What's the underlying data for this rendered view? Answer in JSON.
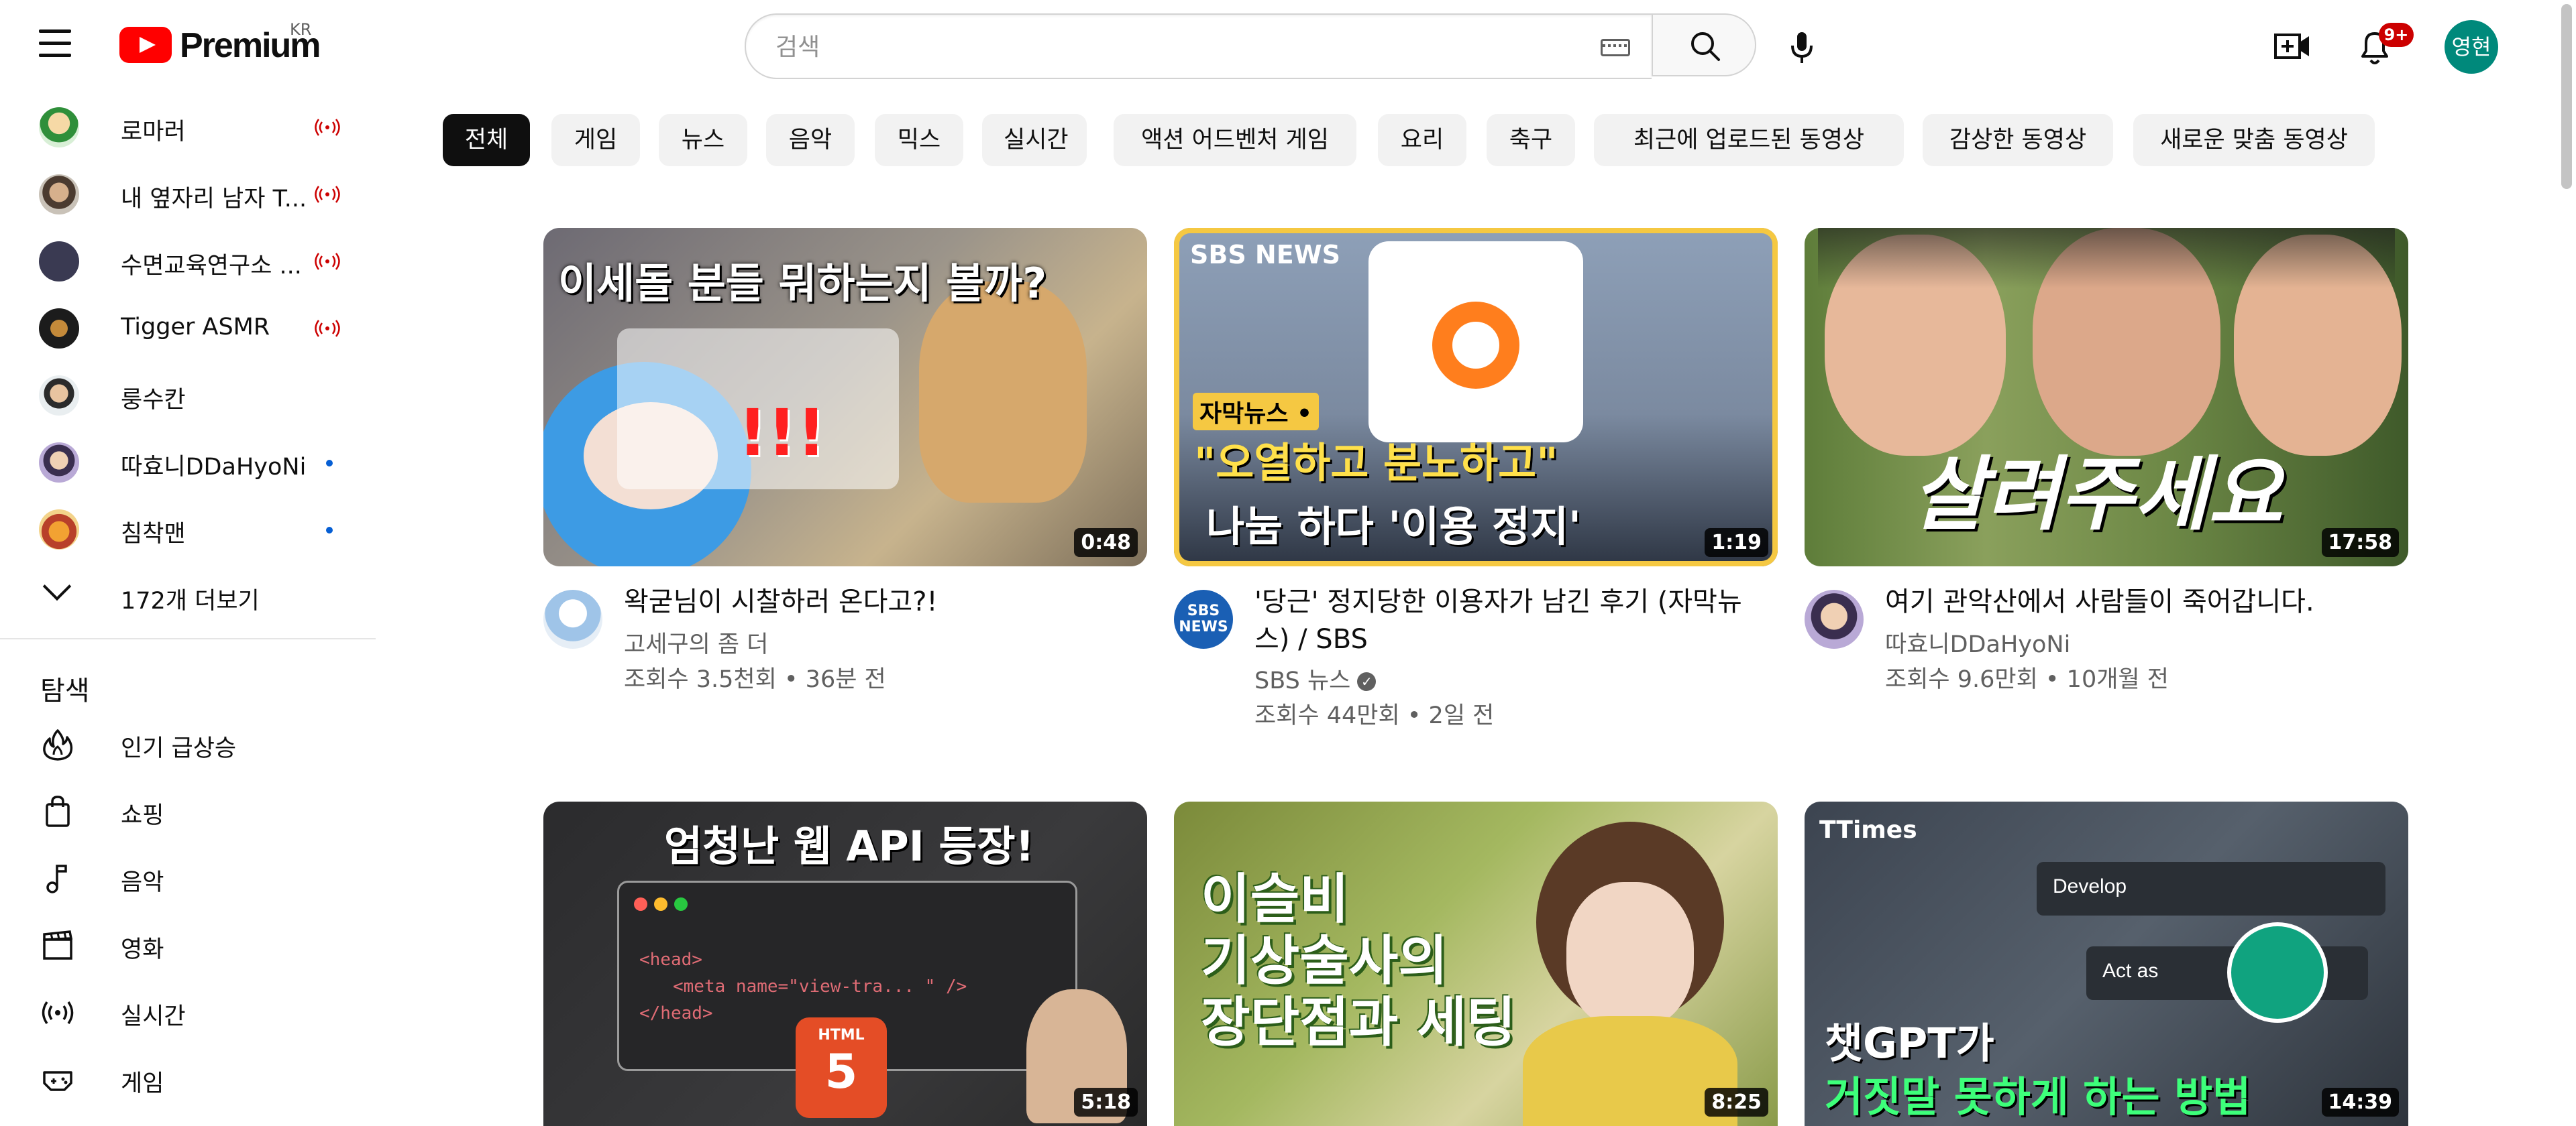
{
  "header": {
    "logo_text": "Premium",
    "region": "KR",
    "search_placeholder": "검색",
    "notification_count": "9+",
    "user_avatar_text": "영현"
  },
  "sidebar": {
    "subscriptions": [
      {
        "name": "로마러",
        "indicator": "live"
      },
      {
        "name": "내 옆자리 남자 T...",
        "indicator": "live"
      },
      {
        "name": "수면교육연구소 ...",
        "indicator": "live"
      },
      {
        "name": "Tigger ASMR",
        "indicator": "live"
      },
      {
        "name": "룽수칸",
        "indicator": "none"
      },
      {
        "name": "따효니DDaHyoNi",
        "indicator": "new"
      },
      {
        "name": "침착맨",
        "indicator": "new"
      }
    ],
    "show_more": "172개 더보기",
    "explore_title": "탐색",
    "explore_items": [
      {
        "label": "인기 급상승",
        "icon": "fire-icon"
      },
      {
        "label": "쇼핑",
        "icon": "shopping-bag-icon"
      },
      {
        "label": "음악",
        "icon": "music-note-icon"
      },
      {
        "label": "영화",
        "icon": "clapperboard-icon"
      },
      {
        "label": "실시간",
        "icon": "live-icon"
      },
      {
        "label": "게임",
        "icon": "gamepad-icon"
      }
    ]
  },
  "chips": [
    "전체",
    "게임",
    "뉴스",
    "음악",
    "믹스",
    "실시간",
    "액션 어드벤처 게임",
    "요리",
    "축구",
    "최근에 업로드된 동영상",
    "감상한 동영상",
    "새로운 맞춤 동영상"
  ],
  "videos": [
    {
      "title": "왁굳님이 시찰하러 온다고?!",
      "channel": "고세구의 좀 더",
      "verified": false,
      "stats": "조회수 3.5천회 • 36분 전",
      "duration": "0:48",
      "thumb_text": "이세돌 분들 뭐하는지 볼까?"
    },
    {
      "title": "'당근' 정지당한 이용자가 남긴 후기 (자막뉴스) / SBS",
      "channel": "SBS 뉴스",
      "verified": true,
      "stats": "조회수 44만회 • 2일 전",
      "duration": "1:19",
      "thumb_text_1": "\"오열하고 분노하고\"",
      "thumb_text_2": "나눔 하다 '이용 정지'",
      "thumb_tag": "자막뉴스 •",
      "thumb_brand": "SBS NEWS"
    },
    {
      "title": "여기 관악산에서 사람들이 죽어갑니다.",
      "channel": "따효니DDaHyoNi",
      "verified": false,
      "stats": "조회수 9.6만회 • 10개월 전",
      "duration": "17:58",
      "thumb_text": "살려주세요"
    },
    {
      "title": "",
      "channel": "",
      "verified": false,
      "stats": "",
      "duration": "5:18",
      "thumb_text": "엄청난 웹 API 등장!",
      "code_line_1": "<head>",
      "code_line_2": "<meta name=\"view-tra... \" />",
      "code_line_3": "</head>",
      "html_badge": "HTML"
    },
    {
      "title": "",
      "channel": "",
      "verified": false,
      "stats": "",
      "duration": "8:25",
      "thumb_text_1": "이슬비",
      "thumb_text_2": "기상술사의",
      "thumb_text_3": "장단점과 세팅"
    },
    {
      "title": "",
      "channel": "",
      "verified": false,
      "stats": "",
      "duration": "14:39",
      "thumb_text_1": "챗GPT가",
      "thumb_text_2": "거짓말 못하게 하는 방법",
      "thumb_brand": "TTimes",
      "prompt_1": "Develop",
      "prompt_2": "Act as"
    }
  ],
  "colors": {
    "youtube_red": "#ff0000",
    "chip_active": "#0f0f0f",
    "chip_bg": "#f2f2f2",
    "live_red": "#cc0000",
    "new_dot_blue": "#065fd4",
    "avatar_teal": "#00897b"
  }
}
